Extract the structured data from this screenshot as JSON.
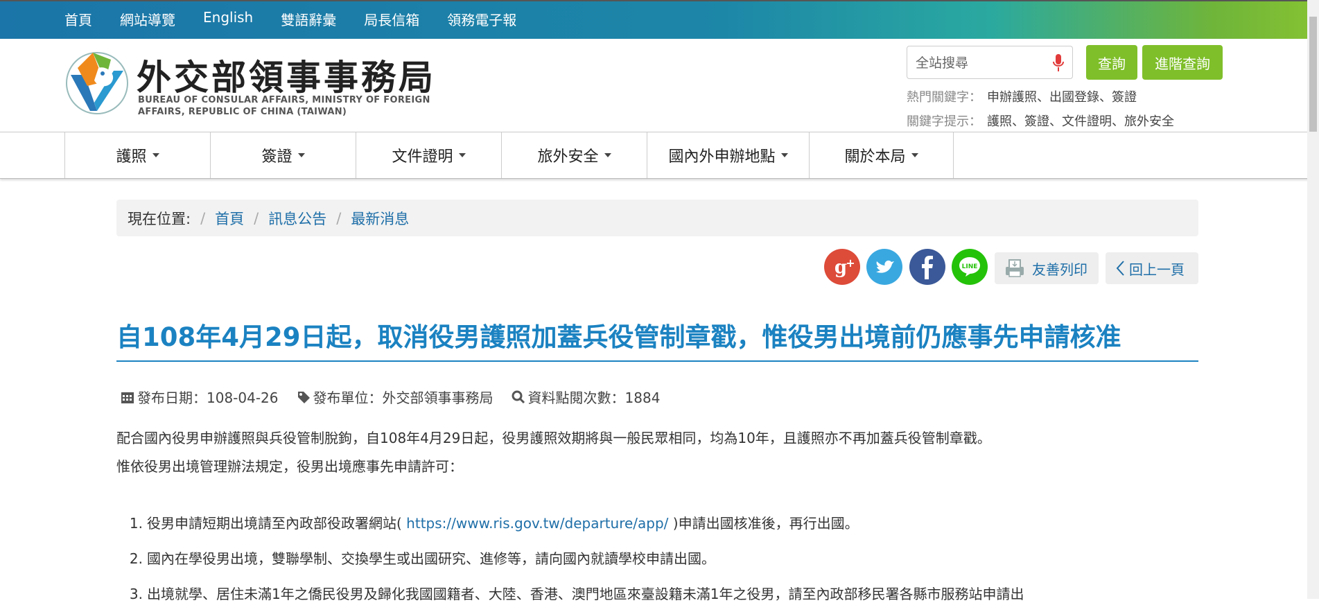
{
  "topnav": [
    "首頁",
    "網站導覽",
    "English",
    "雙語辭彙",
    "局長信箱",
    "領務電子報"
  ],
  "header": {
    "title": "外交部領事事務局",
    "subtitle_line1": "BUREAU OF CONSULAR AFFAIRS, MINISTRY OF FOREIGN",
    "subtitle_line2": "AFFAIRS, REPUBLIC OF CHINA (TAIWAN)",
    "search_placeholder": "全站搜尋",
    "query_btn": "查詢",
    "adv_btn": "進階查詢",
    "hot_label": "熱門關鍵字：",
    "hot_value": "申辦護照、出國登錄、簽證",
    "hint_label": "關鍵字提示：",
    "hint_value": "護照、簽證、文件證明、旅外安全"
  },
  "mainnav": [
    "護照",
    "簽證",
    "文件證明",
    "旅外安全",
    "國內外申辦地點",
    "關於本局"
  ],
  "breadcrumb": {
    "here": "現在位置:",
    "items": [
      "首頁",
      "訊息公告",
      "最新消息"
    ]
  },
  "tools": {
    "print": "友善列印",
    "back": "回上一頁"
  },
  "article": {
    "title": "自108年4月29日起，取消役男護照加蓋兵役管制章戳，惟役男出境前仍應事先申請核准",
    "date": "發布日期：108-04-26",
    "unit": "發布單位：外交部領事事務局",
    "views": "資料點閱次數：1884",
    "p1": "配合國內役男申辦護照與兵役管制脫鉤，自108年4月29日起，役男護照效期將與一般民眾相同，均為10年，且護照亦不再加蓋兵役管制章戳。",
    "p2": "惟依役男出境管理辦法規定，役男出境應事先申請許可：",
    "items": [
      {
        "num": "1.",
        "pre": "役男申請短期出境請至內政部役政署網站(",
        "link": " https://www.ris.gov.tw/departure/app/ ",
        "post": ")申請出國核准後，再行出國。"
      },
      {
        "num": "2.",
        "text": "國內在學役男出境，雙聯學制、交換學生或出國研究、進修等，請向國內就讀學校申請出國。"
      },
      {
        "num": "3.",
        "text": "出境就學、居住未滿1年之僑民役男及歸化我國國籍者、大陸、香港、澳門地區來臺設籍未滿1年之役男，請至內政部移民署各縣市服務站申請出"
      }
    ]
  },
  "colors": {
    "accent_blue": "#1b82c1",
    "green_btn": "#7fbf2a",
    "link": "#1f6fa8"
  }
}
